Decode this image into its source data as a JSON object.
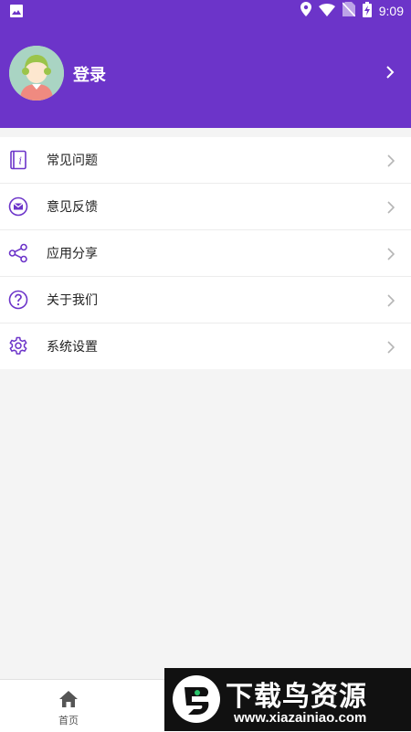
{
  "status_bar": {
    "time": "9:09",
    "icons": [
      "image-icon",
      "location-icon",
      "wifi-icon",
      "no-sim-icon",
      "battery-charging-icon"
    ]
  },
  "header": {
    "login_label": "登录",
    "avatar": "user-avatar"
  },
  "menu": [
    {
      "label": "常见问题",
      "icon": "info-book-icon"
    },
    {
      "label": "意见反馈",
      "icon": "mail-icon"
    },
    {
      "label": "应用分享",
      "icon": "share-icon"
    },
    {
      "label": "关于我们",
      "icon": "question-icon"
    },
    {
      "label": "系统设置",
      "icon": "gear-icon"
    }
  ],
  "bottom_nav": {
    "home_label": "首页"
  },
  "banner": {
    "title": "下载鸟资源",
    "url": "www.xiazainiao.com"
  },
  "colors": {
    "accent": "#6c34c9",
    "background": "#f4f4f4"
  }
}
